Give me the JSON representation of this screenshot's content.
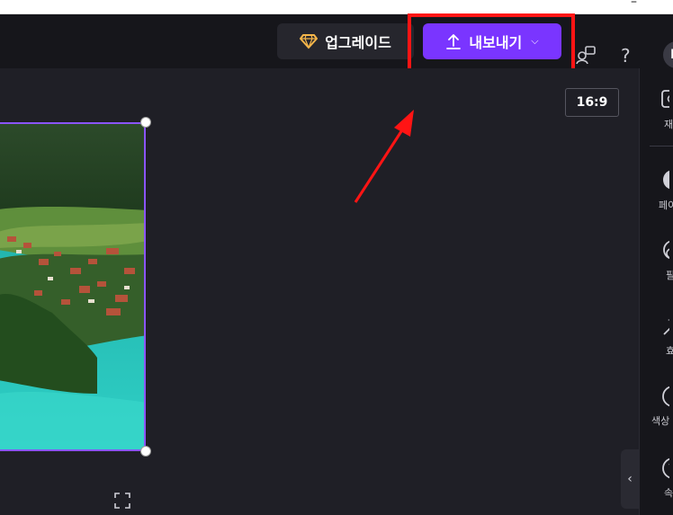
{
  "browser": {
    "window_control": "–"
  },
  "header": {
    "upgrade_label": "업그레이드",
    "export_label": "내보내기",
    "avatar_initial": "M",
    "help_glyph": "?"
  },
  "canvas": {
    "aspect_ratio_label": "16:9"
  },
  "right_panel": {
    "items": [
      {
        "label": "재",
        "icon": "screen-icon"
      },
      {
        "label": "페이",
        "icon": "fade-icon"
      },
      {
        "label": "필",
        "icon": "filter-icon"
      },
      {
        "label": "효",
        "icon": "magic-wand-icon"
      },
      {
        "label": "색상",
        "icon": "color-icon"
      },
      {
        "label": "속",
        "icon": "speed-icon"
      }
    ],
    "collapse_glyph": "‹"
  },
  "colors": {
    "export_button": "#7a35ff",
    "highlight": "#ff1414",
    "selection_border": "#8a55ff",
    "background": "#1f1f26"
  }
}
